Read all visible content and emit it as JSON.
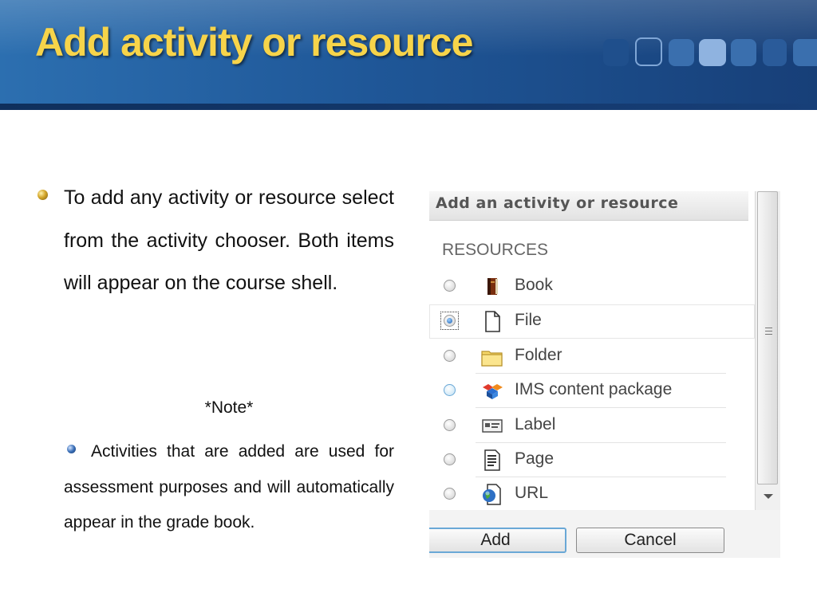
{
  "slide": {
    "title": "Add activity or resource",
    "main_text": "To add any activity or resource select from the activity chooser.  Both items will appear on the course shell.",
    "note": "*Note*",
    "sub_text": "Activities that are added are used for assessment purposes and will automatically appear in the grade book."
  },
  "dialog": {
    "title": "Add an activity or resource",
    "section_heading": "RESOURCES",
    "options": [
      {
        "label": "Book",
        "icon": "book-icon",
        "selected": false
      },
      {
        "label": "File",
        "icon": "file-icon",
        "selected": true
      },
      {
        "label": "Folder",
        "icon": "folder-icon",
        "selected": false
      },
      {
        "label": "IMS content package",
        "icon": "ims-package-icon",
        "selected": false
      },
      {
        "label": "Label",
        "icon": "label-icon",
        "selected": false
      },
      {
        "label": "Page",
        "icon": "page-icon",
        "selected": false
      },
      {
        "label": "URL",
        "icon": "url-icon",
        "selected": false
      }
    ],
    "buttons": {
      "add": "Add",
      "cancel": "Cancel"
    }
  },
  "colors": {
    "header_blue": "#1f5798",
    "title_yellow": "#f7d44a",
    "focus_blue": "#6aa8d6"
  }
}
